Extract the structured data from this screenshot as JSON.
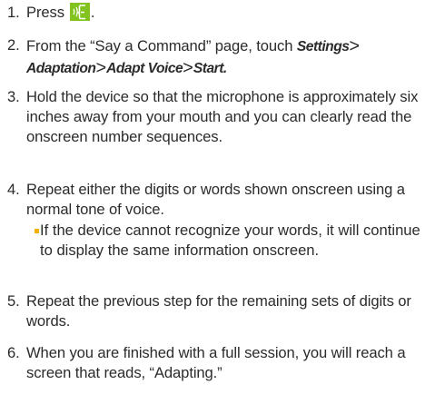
{
  "steps": [
    {
      "number": "1.",
      "prefix": "Press",
      "suffix": "."
    },
    {
      "number": "2.",
      "text_before": "From the “Say a Command” page, touch ",
      "ui_settings": "Settings",
      "gt": ">",
      "ui_adaptation": "Adaptation",
      "ui_adapt_voice": "Adapt Voice",
      "ui_start": "Start",
      "end": "."
    },
    {
      "number": "3.",
      "text": "Hold the device so that the microphone is approximately six inches away from your mouth and you can clearly read the onscreen number sequences."
    },
    {
      "number": "4.",
      "text": "Repeat either the digits or words shown onscreen using a normal tone of voice."
    },
    {
      "number": "5.",
      "text": "Repeat the previous step for the remaining sets of digits or words."
    },
    {
      "number": "6.",
      "text": "When you are finished with a full session, you will reach a screen that reads, “Adapting.”"
    }
  ],
  "bullet": {
    "text": "If the device cannot recognize your words, it will continue to display the same information onscreen."
  },
  "colors": {
    "icon_background": "#83c31f",
    "bullet": "#f3b000",
    "text": "#2b2b2b"
  },
  "icons": {
    "voice_command": "voice-command-icon"
  }
}
